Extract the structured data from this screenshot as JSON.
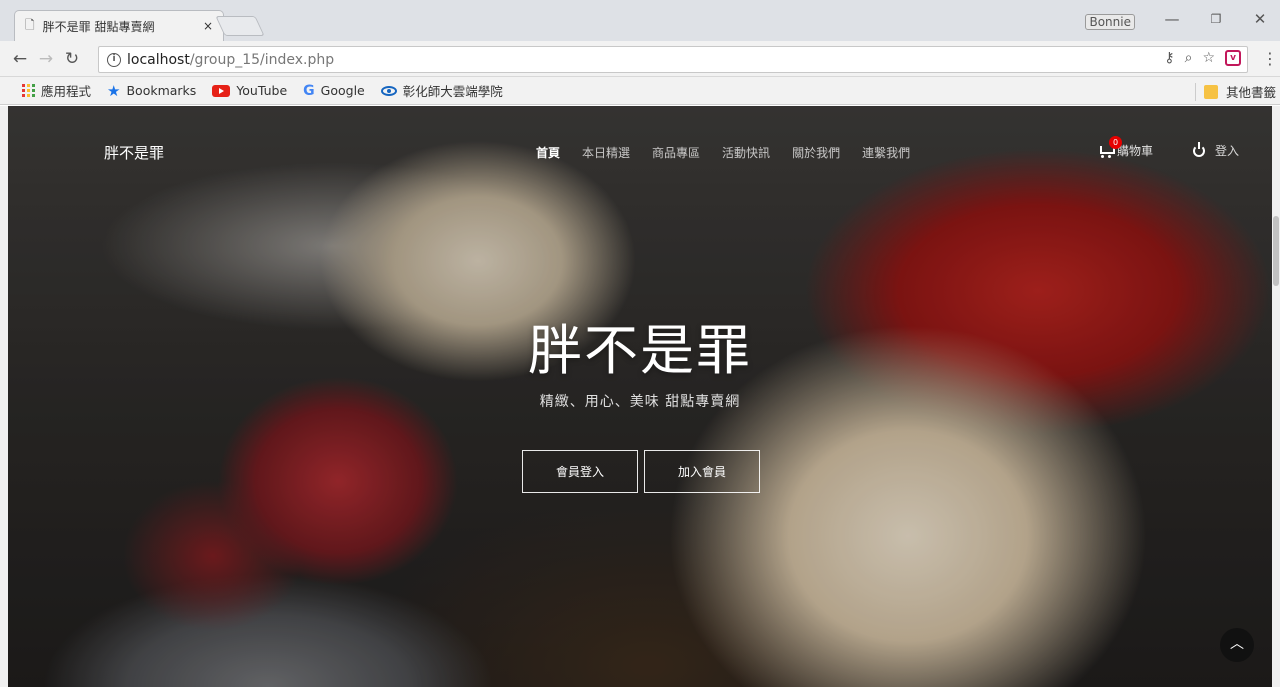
{
  "browser": {
    "tab_title": "胖不是罪 甜點專賣網",
    "tab_close": "×",
    "profile_name": "Bonnie",
    "url_host": "localhost",
    "url_path": "/group_15/index.php",
    "bookmarks": [
      {
        "label": "應用程式",
        "icon": "apps-icon"
      },
      {
        "label": "Bookmarks",
        "icon": "star-icon"
      },
      {
        "label": "YouTube",
        "icon": "youtube-icon"
      },
      {
        "label": "Google",
        "icon": "google-icon"
      },
      {
        "label": "彰化師大雲端學院",
        "icon": "eye-icon"
      }
    ],
    "other_bookmarks": "其他書籤"
  },
  "site": {
    "logo": "胖不是罪",
    "nav": [
      "首頁",
      "本日精選",
      "商品專區",
      "活動快訊",
      "關於我們",
      "連繫我們"
    ],
    "active_nav": "首頁",
    "cart_label": "購物車",
    "cart_count": "0",
    "login_label": "登入"
  },
  "hero": {
    "title": "胖不是罪",
    "subtitle": "精緻、用心、美味 甜點專賣網",
    "login_button": "會員登入",
    "signup_button": "加入會員"
  }
}
